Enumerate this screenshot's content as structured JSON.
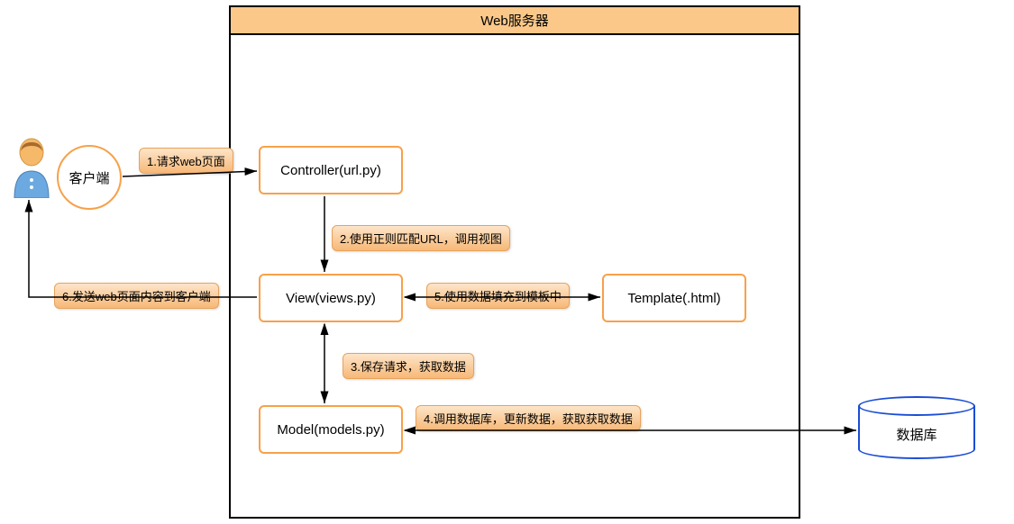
{
  "server_title": "Web服务器",
  "actor": {
    "client": "客户端",
    "database": "数据库"
  },
  "nodes": {
    "controller": "Controller(url.py)",
    "view": "View(views.py)",
    "model": "Model(models.py)",
    "template": "Template(.html)"
  },
  "edges": {
    "step1": "1.请求web页面",
    "step2": "2.使用正则匹配URL，调用视图",
    "step3": "3.保存请求，获取数据",
    "step4": "4.调用数据库，更新数据，获取获取数据",
    "step5": "5.使用数据填充到模板中",
    "step6": "6.发送web页面内容到客户端"
  }
}
